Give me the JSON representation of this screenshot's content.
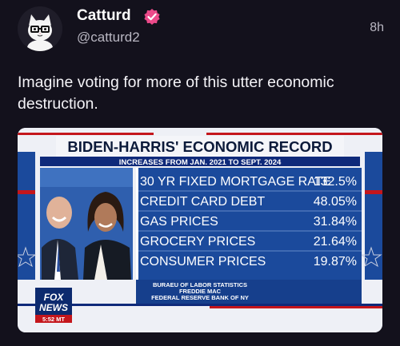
{
  "post": {
    "author_name": "Catturd",
    "handle": "@catturd2",
    "timestamp": "8h",
    "text": "Imagine voting for more of this utter economic destruction."
  },
  "graphic": {
    "headline": "BIDEN-HARRIS' ECONOMIC RECORD",
    "subheadline": "INCREASES FROM JAN. 2021 TO SEPT. 2024",
    "rows": [
      {
        "label": "30 YR FIXED MORTGAGE RATE",
        "value": "132.5%"
      },
      {
        "label": "CREDIT CARD DEBT",
        "value": "48.05%"
      },
      {
        "label": "GAS PRICES",
        "value": "31.84%"
      },
      {
        "label": "GROCERY PRICES",
        "value": "21.64%"
      },
      {
        "label": "CONSUMER PRICES",
        "value": "19.87%"
      }
    ],
    "sources": [
      "BURAEU OF LABOR STATISTICS",
      "FREDDIE MAC",
      "FEDERAL RESERVE BANK OF NY"
    ],
    "network_logo": {
      "line1": "FOX",
      "line2": "NEWS",
      "time": "5:52 MT"
    }
  },
  "colors": {
    "background": "#13111c",
    "verified_badge": "#ec4a8a",
    "graphic_navy": "#0f2a7a",
    "graphic_panel": "#1b4a9c",
    "graphic_red": "#c4161c"
  },
  "icons": {
    "verified": "verified-badge-icon",
    "avatar": "cat-avatar-icon"
  }
}
